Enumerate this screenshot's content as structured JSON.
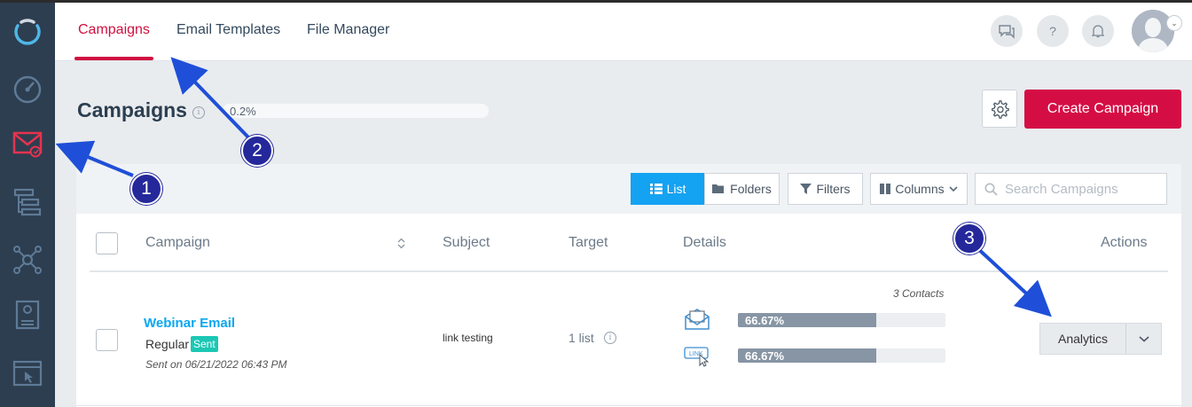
{
  "colors": {
    "sidebar": "#2d3e50",
    "accent": "#d50d45",
    "link": "#0aa7f0",
    "list_active": "#14a2f2",
    "sent_badge": "#1cc7b4",
    "annotation": "#24289a"
  },
  "sidebar": {
    "icons": [
      "logo-ring-icon",
      "dashboard-gauge-icon",
      "email-campaigns-icon",
      "workflow-icon",
      "network-icon",
      "forms-icon",
      "landing-page-icon"
    ]
  },
  "topnav": {
    "tabs": [
      {
        "label": "Campaigns",
        "active": true
      },
      {
        "label": "Email Templates",
        "active": false
      },
      {
        "label": "File Manager",
        "active": false
      }
    ],
    "icons": [
      "chat-icon",
      "help-icon",
      "bell-icon",
      "avatar"
    ],
    "help_glyph": "?"
  },
  "header": {
    "title": "Campaigns",
    "usage_text": "0.2%",
    "create_label": "Create Campaign"
  },
  "toolbar": {
    "list_label": "List",
    "folders_label": "Folders",
    "filters_label": "Filters",
    "columns_label": "Columns",
    "search_placeholder": "Search Campaigns"
  },
  "table": {
    "headers": {
      "campaign": "Campaign",
      "subject": "Subject",
      "target": "Target",
      "details": "Details",
      "actions": "Actions"
    },
    "rows": [
      {
        "name": "Webinar Email",
        "type": "Regular",
        "status": "Sent",
        "sent_on": "Sent on 06/21/2022 06:43 PM",
        "subject": "link testing",
        "target": "1 list",
        "contacts": "3 Contacts",
        "open_rate": "66.67%",
        "open_fraction": 0.6667,
        "click_rate": "66.67%",
        "click_fraction": 0.6667,
        "action_label": "Analytics"
      }
    ]
  },
  "annotations": {
    "markers": [
      "1",
      "2",
      "3"
    ]
  }
}
